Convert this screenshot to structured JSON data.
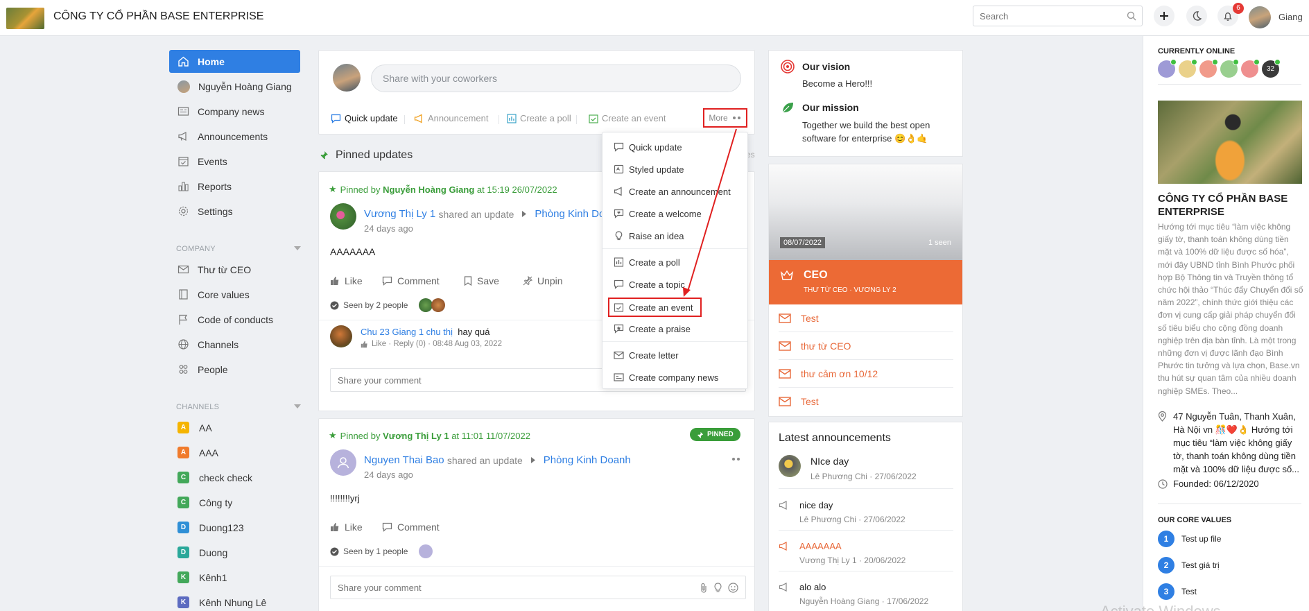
{
  "header": {
    "company_name": "CÔNG TY CỔ PHẦN BASE ENTERPRISE",
    "search_placeholder": "Search",
    "notification_count": "6",
    "username": "Giang"
  },
  "sidebar": {
    "nav": [
      {
        "label": "Home",
        "icon": "home-icon",
        "active": true
      },
      {
        "label": "Nguyễn Hoàng Giang",
        "icon": "avatar"
      },
      {
        "label": "Company news",
        "icon": "news-icon"
      },
      {
        "label": "Announcements",
        "icon": "megaphone-icon"
      },
      {
        "label": "Events",
        "icon": "calendar-check-icon"
      },
      {
        "label": "Reports",
        "icon": "bar-chart-icon"
      },
      {
        "label": "Settings",
        "icon": "gear-icon"
      }
    ],
    "company_heading": "COMPANY",
    "company_items": [
      {
        "label": "Thư từ CEO",
        "icon": "mail-icon"
      },
      {
        "label": "Core values",
        "icon": "book-icon"
      },
      {
        "label": "Code of conducts",
        "icon": "flag-icon"
      },
      {
        "label": "Channels",
        "icon": "globe-icon"
      },
      {
        "label": "People",
        "icon": "people-icon"
      }
    ],
    "channels_heading": "CHANNELS",
    "channels": [
      {
        "letter": "A",
        "label": "AA",
        "color": "#f5b400"
      },
      {
        "letter": "A",
        "label": "AAA",
        "color": "#f07b2c"
      },
      {
        "letter": "C",
        "label": "check check",
        "color": "#43a85a"
      },
      {
        "letter": "C",
        "label": "Công ty",
        "color": "#43a85a"
      },
      {
        "letter": "D",
        "label": "Duong123",
        "color": "#2f8fd6"
      },
      {
        "letter": "D",
        "label": "Duong",
        "color": "#2aa89a"
      },
      {
        "letter": "K",
        "label": "Kênh1",
        "color": "#43a85a"
      },
      {
        "letter": "K",
        "label": "Kênh Nhung Lê",
        "color": "#5c6bc0"
      }
    ]
  },
  "composer": {
    "placeholder": "Share with your coworkers",
    "tabs": [
      {
        "label": "Quick update",
        "icon": "chat-bubble-icon"
      },
      {
        "label": "Announcement",
        "icon": "megaphone-icon"
      },
      {
        "label": "Create a poll",
        "icon": "poll-icon"
      },
      {
        "label": "Create an event",
        "icon": "calendar-check-icon"
      }
    ],
    "more_label": "More"
  },
  "more_menu": [
    {
      "label": "Quick update",
      "icon": "chat-bubble-icon"
    },
    {
      "label": "Styled update",
      "icon": "styled-icon"
    },
    {
      "label": "Create an announcement",
      "icon": "megaphone-icon"
    },
    {
      "label": "Create a welcome",
      "icon": "heart-bubble-icon"
    },
    {
      "label": "Raise an idea",
      "icon": "lightbulb-icon"
    },
    {
      "label": "Create a poll",
      "icon": "poll-icon"
    },
    {
      "label": "Create a topic",
      "icon": "chat-bubble-icon"
    },
    {
      "label": "Create an event",
      "icon": "calendar-check-icon"
    },
    {
      "label": "Create a praise",
      "icon": "praise-icon"
    },
    {
      "label": "Create letter",
      "icon": "letter-icon"
    },
    {
      "label": "Create company news",
      "icon": "news-icon"
    }
  ],
  "pinned": {
    "heading": "Pinned updates",
    "heading_suffix": "es"
  },
  "post1": {
    "pinned_prefix": "Pinned by",
    "pinned_by": "Nguyễn Hoàng Giang",
    "pinned_at": "at 15:19 26/07/2022",
    "author": "Vương Thị Ly 1",
    "verb": "shared an update",
    "target": "Phòng Kinh Doa",
    "time": "24 days ago",
    "body": "AAAAAAA",
    "actions": [
      "Like",
      "Comment",
      "Save",
      "Unpin"
    ],
    "seen": "Seen by 2 people",
    "comment": {
      "author": "Chu 23 Giang 1 chu thị",
      "text": "hay quá",
      "like": "Like",
      "meta": "· Reply (0) · 08:48 Aug 03, 2022"
    },
    "comment_placeholder": "Share your comment"
  },
  "post2": {
    "pinned_prefix": "Pinned by",
    "pinned_by": "Vương Thị Ly 1",
    "pinned_at": "at 11:01 11/07/2022",
    "badge": "PINNED",
    "author": "Nguyen Thai Bao",
    "verb": "shared an update",
    "target": "Phòng Kinh Doanh",
    "time": "24 days ago",
    "body": "!!!!!!!!yrj",
    "actions": [
      "Like",
      "Comment"
    ],
    "seen": "Seen by 1 people",
    "comment_placeholder": "Share your comment"
  },
  "vision": {
    "vision_title": "Our vision",
    "vision_text": "Become a Hero!!!",
    "mission_title": "Our mission",
    "mission_text": "Together we build the best open software for enterprise 😊👌🤙"
  },
  "ceo": {
    "date": "08/07/2022",
    "seen": "1 seen",
    "title": "CEO",
    "subtitle": "THƯ TỪ CEO · VƯƠNG LY 2",
    "links": [
      "Test",
      "thư từ CEO",
      "thư cảm ơn 10/12",
      "Test"
    ]
  },
  "announcements": {
    "heading": "Latest announcements",
    "items": [
      {
        "title": "NIce day",
        "meta": "Lê Phương Chi · 27/06/2022",
        "featured": true
      },
      {
        "title": "nice day",
        "meta": "Lê Phương Chi · 27/06/2022"
      },
      {
        "title": "AAAAAAA",
        "meta": "Vương Thị Ly 1 · 20/06/2022",
        "highlight": true
      },
      {
        "title": "alo alo",
        "meta": "Nguyễn Hoàng Giang · 17/06/2022"
      }
    ]
  },
  "right_panel": {
    "online_heading": "CURRENTLY ONLINE",
    "online_more": "32",
    "company_name": "CÔNG TY CỔ PHẦN BASE ENTERPRISE",
    "description": "Hướng tới mục tiêu “làm việc không giấy tờ, thanh toán không dùng tiền mặt và 100% dữ liệu được số hóa”, mới đây UBND tỉnh Bình Phước phối hợp Bộ Thông tin và Truyền thông tổ chức hội thảo “Thúc đẩy Chuyển đổi số năm 2022”, chính thức giới thiệu các đơn vị cung cấp giải pháp chuyển đổi số tiêu biểu cho cộng đồng doanh nghiệp trên địa bàn tỉnh. Là một trong những đơn vị được lãnh đạo Bình Phước tin tưởng và lựa chọn, Base.vn thu hút sự quan tâm của nhiều doanh nghiệp SMEs. Theo...",
    "address": "47 Nguyễn Tuân, Thanh Xuân, Hà Nội vn 🎊❤️👌 Hướng tới mục tiêu “làm việc không giấy tờ, thanh toán không dùng tiền mặt và 100% dữ liệu được số...",
    "founded": "Founded: 06/12/2020",
    "core_values_heading": "OUR CORE VALUES",
    "core_values": [
      {
        "num": "1",
        "label": "Test up file"
      },
      {
        "num": "2",
        "label": "Test giá trị"
      },
      {
        "num": "3",
        "label": "Test"
      }
    ]
  },
  "watermark": "Activate Windows",
  "colors": {
    "accent": "#2f7fe3",
    "ceo": "#ec6a35",
    "highlight_box": "#e02020",
    "pinned_green": "#3a9d3a"
  }
}
